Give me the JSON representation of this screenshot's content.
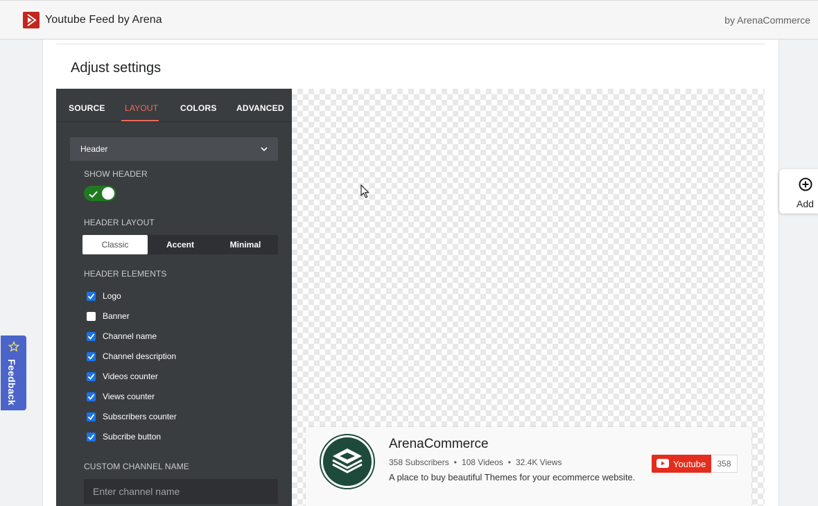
{
  "app": {
    "title": "Youtube Feed by Arena",
    "by": "by ArenaCommerce"
  },
  "page": {
    "section_title": "Adjust settings"
  },
  "tabs": [
    {
      "label": "SOURCE",
      "active": false
    },
    {
      "label": "LAYOUT",
      "active": true
    },
    {
      "label": "COLORS",
      "active": false
    },
    {
      "label": "ADVANCED",
      "active": false
    }
  ],
  "settings": {
    "header_dropdown": "Header",
    "show_header_label": "SHOW HEADER",
    "show_header_on": true,
    "header_layout_label": "HEADER LAYOUT",
    "header_layout_options": [
      "Classic",
      "Accent",
      "Minimal"
    ],
    "header_layout_selected": "Classic",
    "header_elements_label": "HEADER ELEMENTS",
    "header_elements": [
      {
        "label": "Logo",
        "checked": true
      },
      {
        "label": "Banner",
        "checked": false
      },
      {
        "label": "Channel name",
        "checked": true
      },
      {
        "label": "Channel description",
        "checked": true
      },
      {
        "label": "Videos counter",
        "checked": true
      },
      {
        "label": "Views counter",
        "checked": true
      },
      {
        "label": "Subscribers counter",
        "checked": true
      },
      {
        "label": "Subcribe button",
        "checked": true
      }
    ],
    "custom_channel_name_label": "CUSTOM CHANNEL NAME",
    "custom_channel_name_placeholder": "Enter channel name",
    "custom_channel_name_value": ""
  },
  "preview": {
    "channel_name": "ArenaCommerce",
    "subscribers": "358 Subscribers",
    "videos": "108 Videos",
    "views": "32.4K Views",
    "separator": "•",
    "description": "A place to buy beautiful Themes for your ecommerce website.",
    "subscribe_label": "Youtube",
    "subscribe_count": "358"
  },
  "side": {
    "add_label": "Add",
    "feedback_label": "Feedback"
  },
  "colors": {
    "brand_red": "#c4261e",
    "active_tab": "#f06a5a",
    "panel_bg": "#3a3d40",
    "toggle_on": "#1f7a1f",
    "checkbox_on": "#1a73e8",
    "youtube_red": "#e52d1d",
    "feedback_bg": "#4b64c9",
    "channel_logo_green": "#1e4a3c"
  },
  "icons": {
    "app_logo": "play-triangle-icon",
    "dropdown": "chevron-down-icon",
    "toggle": "check-icon",
    "add": "plus-circle-icon",
    "feedback": "star-icon",
    "youtube": "youtube-play-icon",
    "cursor": "mouse-pointer-icon"
  }
}
